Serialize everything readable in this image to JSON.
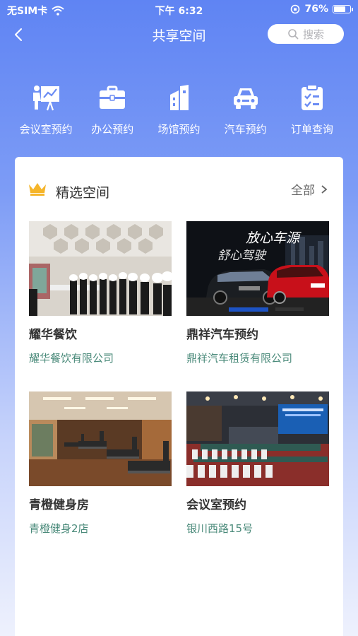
{
  "status_bar": {
    "carrier": "无SIM卡",
    "time": "下午 6:32",
    "battery_percent": "76%",
    "battery_level": 0.76
  },
  "nav": {
    "title": "共享空间",
    "search_label": "搜索"
  },
  "quick_actions": [
    {
      "label": "会议室预约",
      "icon": "presentation-icon"
    },
    {
      "label": "办公预约",
      "icon": "briefcase-icon"
    },
    {
      "label": "场馆预约",
      "icon": "building-icon"
    },
    {
      "label": "汽车预约",
      "icon": "car-icon"
    },
    {
      "label": "订单查询",
      "icon": "clipboard-icon"
    }
  ],
  "featured": {
    "title": "精选空间",
    "all_label": "全部",
    "items": [
      {
        "name": "耀华餐饮",
        "sub": "耀华餐饮有限公司"
      },
      {
        "name": "鼎祥汽车预约",
        "sub": "鼎祥汽车租赁有限公司",
        "banner_line1": "放心车源",
        "banner_line2": "舒心驾驶"
      },
      {
        "name": "青橙健身房",
        "sub": "青橙健身2店"
      },
      {
        "name": "会议室预约",
        "sub": "银川西路15号"
      }
    ]
  },
  "colors": {
    "primary": "#5f84f3",
    "accent_text": "#4a8a7a",
    "crown": "#f5b52a"
  }
}
